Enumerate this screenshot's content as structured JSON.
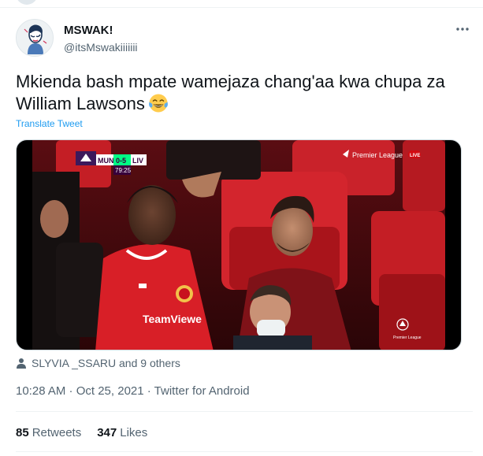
{
  "tweet": {
    "author": {
      "display_name": "MSWAK!",
      "handle": "@itsMswakiiiiiii"
    },
    "text": "Mkienda bash mpate wamejaza chang'aa kwa chupa za William Lawsons",
    "emoji": "face-with-tears-of-joy",
    "translate_label": "Translate Tweet",
    "media": {
      "scoreboard": {
        "home": "MUN",
        "score": "0-5",
        "away": "LIV",
        "clock": "79:25"
      },
      "broadcaster": "Premier League",
      "live_badge": "LIVE",
      "corner_logo_text": "Premier League",
      "shirt_sponsor_fragment": "TeamViewe"
    },
    "liked_by": "SLYVIA _SSARU and 9 others",
    "timestamp": "10:28 AM · Oct 25, 2021 · Twitter for Android",
    "stats": {
      "retweets_count": "85",
      "retweets_label": "Retweets",
      "likes_count": "347",
      "likes_label": "Likes"
    }
  },
  "colors": {
    "link": "#1d9bf0",
    "secondary_text": "#536471",
    "primary_text": "#0f1419",
    "divider": "#eff3f4"
  }
}
